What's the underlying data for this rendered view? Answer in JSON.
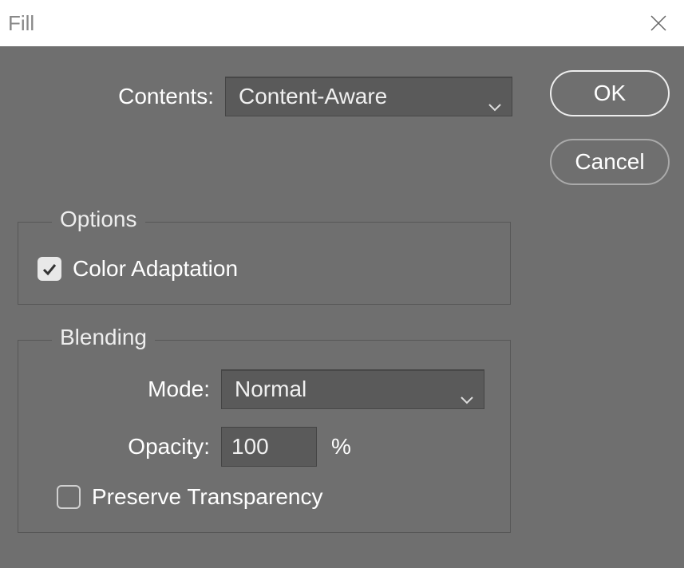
{
  "title": "Fill",
  "contents": {
    "label": "Contents:",
    "value": "Content-Aware"
  },
  "buttons": {
    "ok": "OK",
    "cancel": "Cancel"
  },
  "options": {
    "legend": "Options",
    "color_adaptation": {
      "label": "Color Adaptation",
      "checked": true
    }
  },
  "blending": {
    "legend": "Blending",
    "mode": {
      "label": "Mode:",
      "value": "Normal"
    },
    "opacity": {
      "label": "Opacity:",
      "value": "100",
      "suffix": "%"
    },
    "preserve_transparency": {
      "label": "Preserve Transparency",
      "checked": false
    }
  }
}
